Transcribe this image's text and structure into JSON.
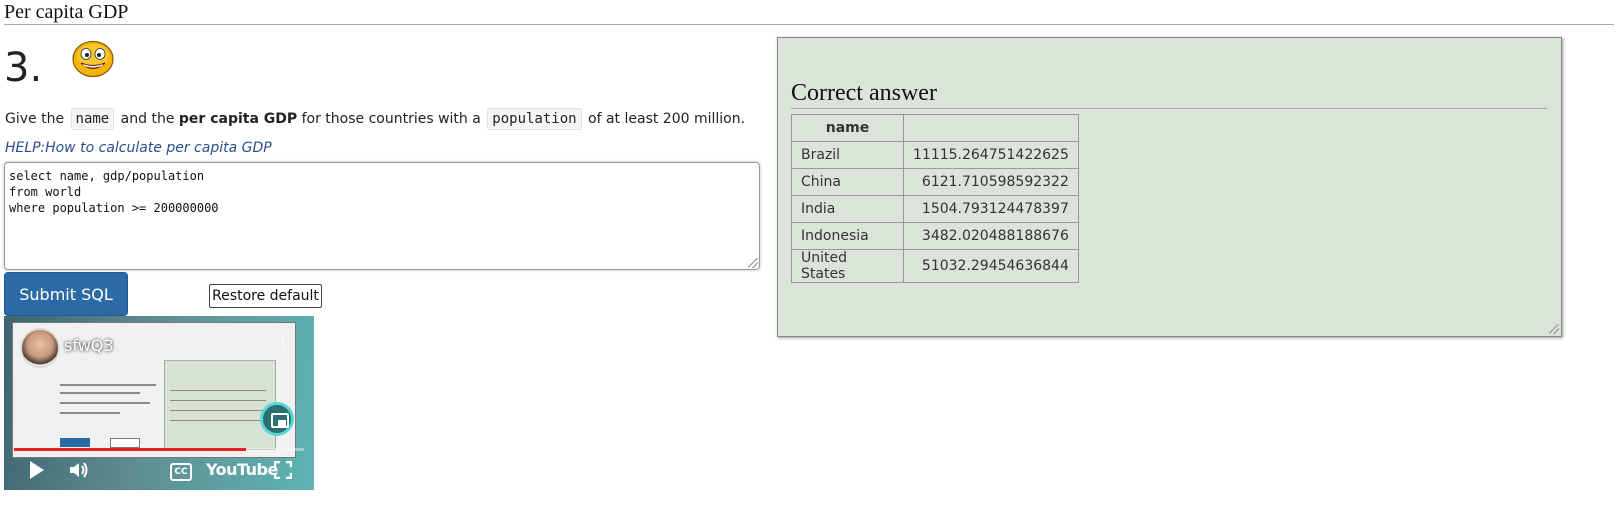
{
  "page": {
    "title": "Per capita GDP"
  },
  "question": {
    "number": "3.",
    "text_1": "Give the ",
    "code_1": "name",
    "text_2": " and the ",
    "bold": "per capita GDP",
    "text_3": " for those countries with a ",
    "code_2": "population",
    "text_4": " of at least 200 million.",
    "help_link": "HELP:How to calculate per capita GDP",
    "smiley_icon": "smiley-face-icon"
  },
  "editor": {
    "sql": "select name, gdp/population\nfrom world\nwhere population >= 200000000"
  },
  "buttons": {
    "submit": "Submit SQL",
    "restore": "Restore default"
  },
  "video": {
    "title": "sfwQ3",
    "logo": "YouTube",
    "cc": "CC",
    "progress": 0.8,
    "icons": [
      "play-icon",
      "volume-icon",
      "cc-icon",
      "fullscreen-icon",
      "pip-icon",
      "more-icon"
    ]
  },
  "answer": {
    "heading": "Correct answer",
    "columns": [
      "name",
      ""
    ],
    "rows": [
      [
        "Brazil",
        "11115.264751422625"
      ],
      [
        "China",
        "6121.710598592322"
      ],
      [
        "India",
        "1504.793124478397"
      ],
      [
        "Indonesia",
        "3482.020488188676"
      ],
      [
        "United States",
        "51032.29454636844"
      ]
    ]
  },
  "colors": {
    "submit_bg": "#2c6aa6",
    "answer_bg": "#dae4d8",
    "link": "#2a4e8a",
    "progress": "#e52222"
  }
}
